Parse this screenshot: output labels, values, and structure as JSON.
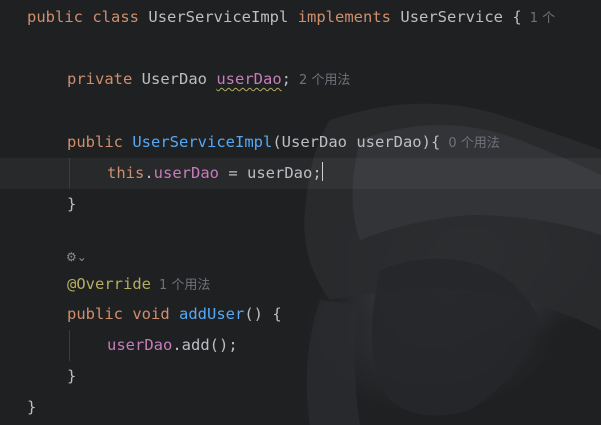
{
  "code": {
    "line1": {
      "public": "public",
      "class": "class",
      "classname": "UserServiceImpl",
      "implements": "implements",
      "iface": "UserService",
      "brace": " {",
      "hint": "1 个"
    },
    "line2": {
      "private": "private",
      "type": "UserDao",
      "field": "userDao",
      "semi": ";",
      "hint": "2 个用法"
    },
    "line3": {
      "public": "public",
      "ctor": "UserServiceImpl",
      "params": "(UserDao userDao){",
      "hint": "0 个用法"
    },
    "line4": {
      "this": "this",
      "dot": ".",
      "field": "userDao",
      "rest": " = userDao;"
    },
    "line5": {
      "close": "}"
    },
    "line6": {
      "icon": "⚙⌄"
    },
    "line7": {
      "annotation": "@Override",
      "hint": "1 个用法"
    },
    "line8": {
      "public": "public",
      "void": "void",
      "method": "addUser",
      "rest": "() {"
    },
    "line9": {
      "field": "userDao",
      "rest": ".add();"
    },
    "line10": {
      "close": "}"
    },
    "line11": {
      "close": "}"
    }
  },
  "icons": {
    "gutter": "edit-icon"
  }
}
